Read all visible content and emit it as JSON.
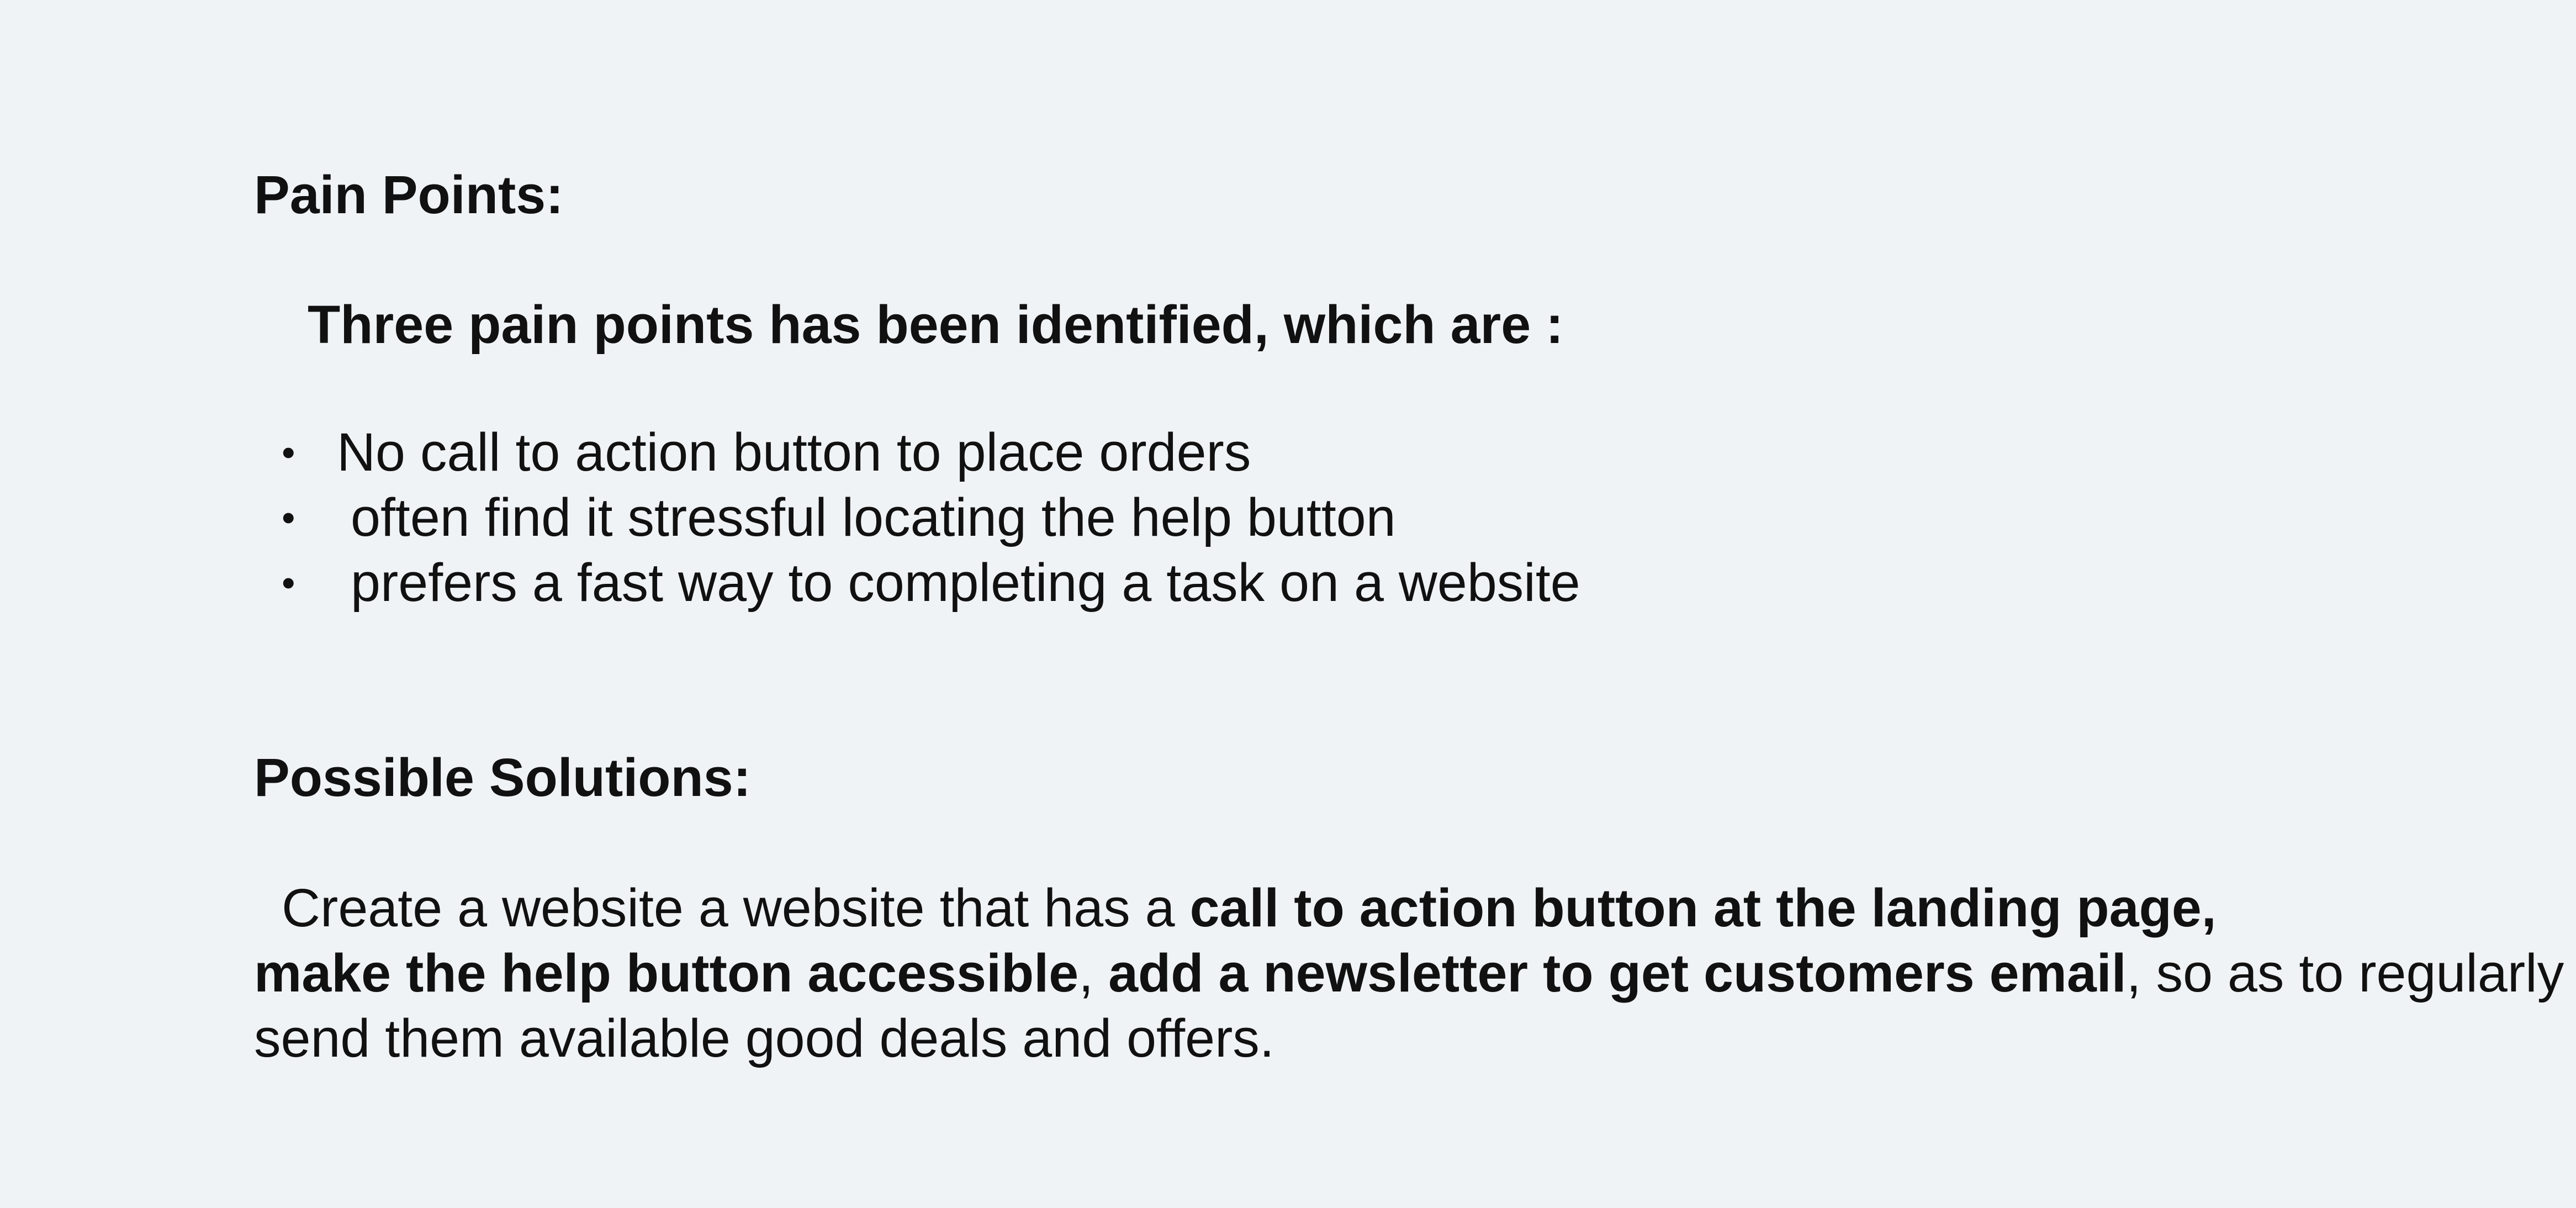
{
  "pain_points": {
    "heading": "Pain Points:",
    "intro": "Three pain points has been identified, which are :",
    "items": [
      "No call to action button to place orders",
      "often find it stressful locating the help button",
      "prefers a fast way to completing a task on a website"
    ]
  },
  "solutions": {
    "heading": "Possible Solutions:",
    "line1": {
      "plain1": "Create a website a website that has a ",
      "bold1": "call to action button at the landing page,"
    },
    "line2": {
      "bold1": "make the help button accessible",
      "plain1": ", ",
      "bold2": "add a newsletter to get customers email",
      "plain2": ", so as to regularly"
    },
    "line3": {
      "plain1": "send them available good deals and offers."
    }
  },
  "colors": {
    "background": "#f0f3f6",
    "text": "#111111"
  },
  "icons": {
    "bullet": "bullet-icon"
  }
}
